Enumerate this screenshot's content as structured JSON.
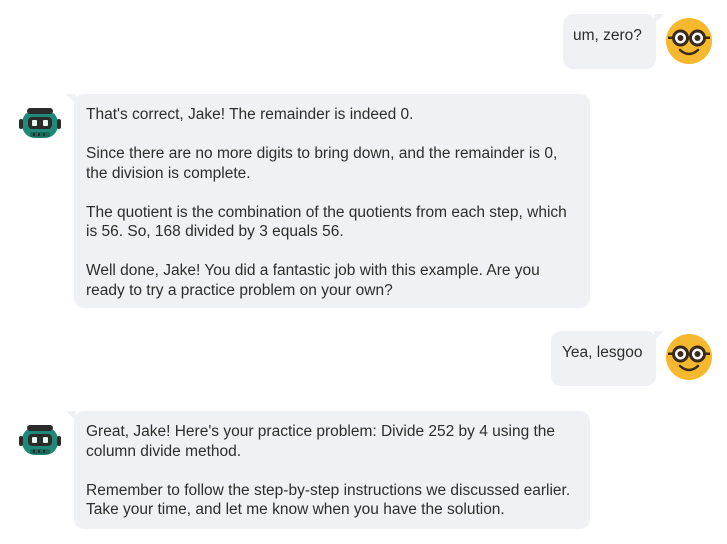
{
  "messages": [
    {
      "role": "user",
      "paragraphs": [
        "um, zero?"
      ]
    },
    {
      "role": "bot",
      "paragraphs": [
        "That's correct, Jake! The remainder is indeed 0.",
        "Since there are no more digits to bring down, and the remainder is 0, the division is complete.",
        "The quotient is the combination of the quotients from each step, which is 56. So, 168 divided by 3 equals 56.",
        "Well done, Jake! You did a fantastic job with this example. Are you ready to try a practice problem on your own?"
      ]
    },
    {
      "role": "user",
      "paragraphs": [
        "Yea, lesgoo"
      ]
    },
    {
      "role": "bot",
      "paragraphs": [
        "Great, Jake! Here's your practice problem: Divide 252 by 4 using the column divide method.",
        "Remember to follow the step-by-step instructions we discussed earlier. Take your time, and let me know when you have the solution."
      ]
    }
  ],
  "avatars": {
    "user_icon": "nerd-face-icon",
    "bot_icon": "robot-icon"
  },
  "colors": {
    "bubble": "#f0f1f4",
    "user_avatar": "#f5b82e",
    "bot_avatar": "#1f8a78"
  }
}
